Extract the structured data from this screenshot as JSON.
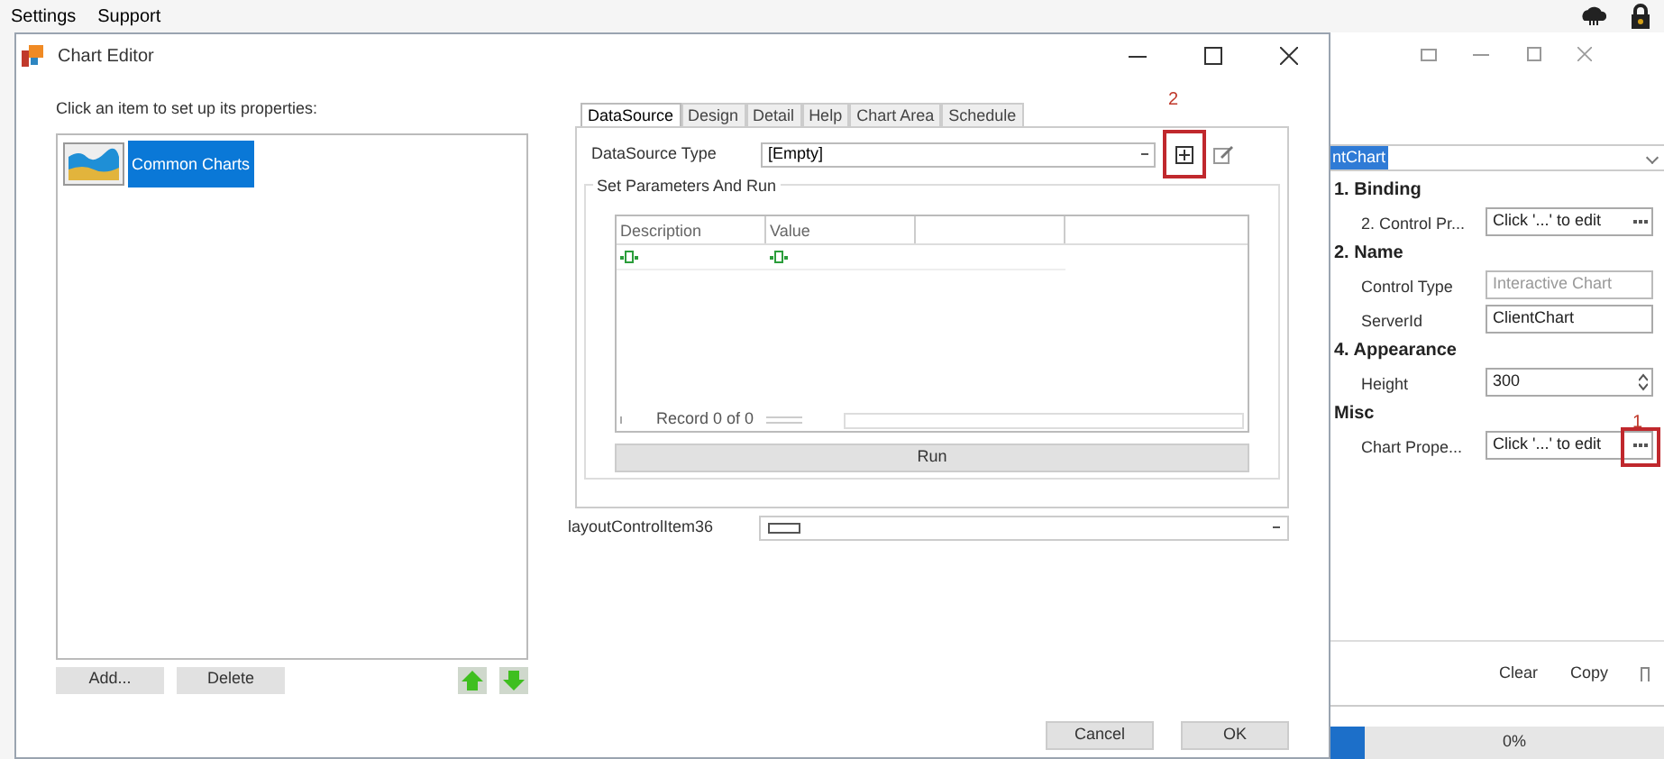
{
  "menu": [
    "Settings",
    "Support"
  ],
  "dialog": {
    "title": "Chart Editor",
    "list_label": "Click an item to set up  its properties:",
    "items": [
      {
        "label": "Common Charts",
        "selected": true
      }
    ],
    "list_buttons": [
      "Add...",
      "Delete"
    ],
    "tabs": [
      {
        "label": "DataSource",
        "selected": true
      },
      {
        "label": "Design",
        "selected": false
      },
      {
        "label": "Detail",
        "selected": false
      },
      {
        "label": "Help",
        "selected": false
      },
      {
        "label": "Chart Area",
        "selected": false
      },
      {
        "label": "Schedule",
        "selected": false
      }
    ],
    "datasource_label": "DataSource Type",
    "datasource_value": "[Empty]",
    "add_annotation": "2",
    "group_title": "Set Parameters And Run",
    "columns": [
      "Description",
      "Value"
    ],
    "navigator": "Record 0 of 0",
    "run": "Run",
    "layout_label": "layoutControlItem36",
    "footer_buttons": [
      "Cancel",
      "OK"
    ]
  },
  "properties": {
    "selector": "ntChart",
    "rows": [
      {
        "kind": "category",
        "label": "1. Binding"
      },
      {
        "kind": "edit",
        "label": "2. Control Pr...",
        "value": "Click '...' to edit"
      },
      {
        "kind": "category",
        "label": "2. Name"
      },
      {
        "kind": "text",
        "label": "Control Type",
        "value": "Interactive Chart",
        "disabled": true
      },
      {
        "kind": "text",
        "label": "ServerId",
        "value": "ClientChart",
        "disabled": false
      },
      {
        "kind": "category",
        "label": "4. Appearance"
      },
      {
        "kind": "spin",
        "label": "Height",
        "value": "300"
      },
      {
        "kind": "category",
        "label": "Misc"
      },
      {
        "kind": "edit",
        "label": "Chart Prope...",
        "value": "Click '...' to edit",
        "annotation": "1"
      }
    ],
    "actions": [
      "Clear",
      "Copy"
    ],
    "progress": "0%",
    "level": 0
  }
}
